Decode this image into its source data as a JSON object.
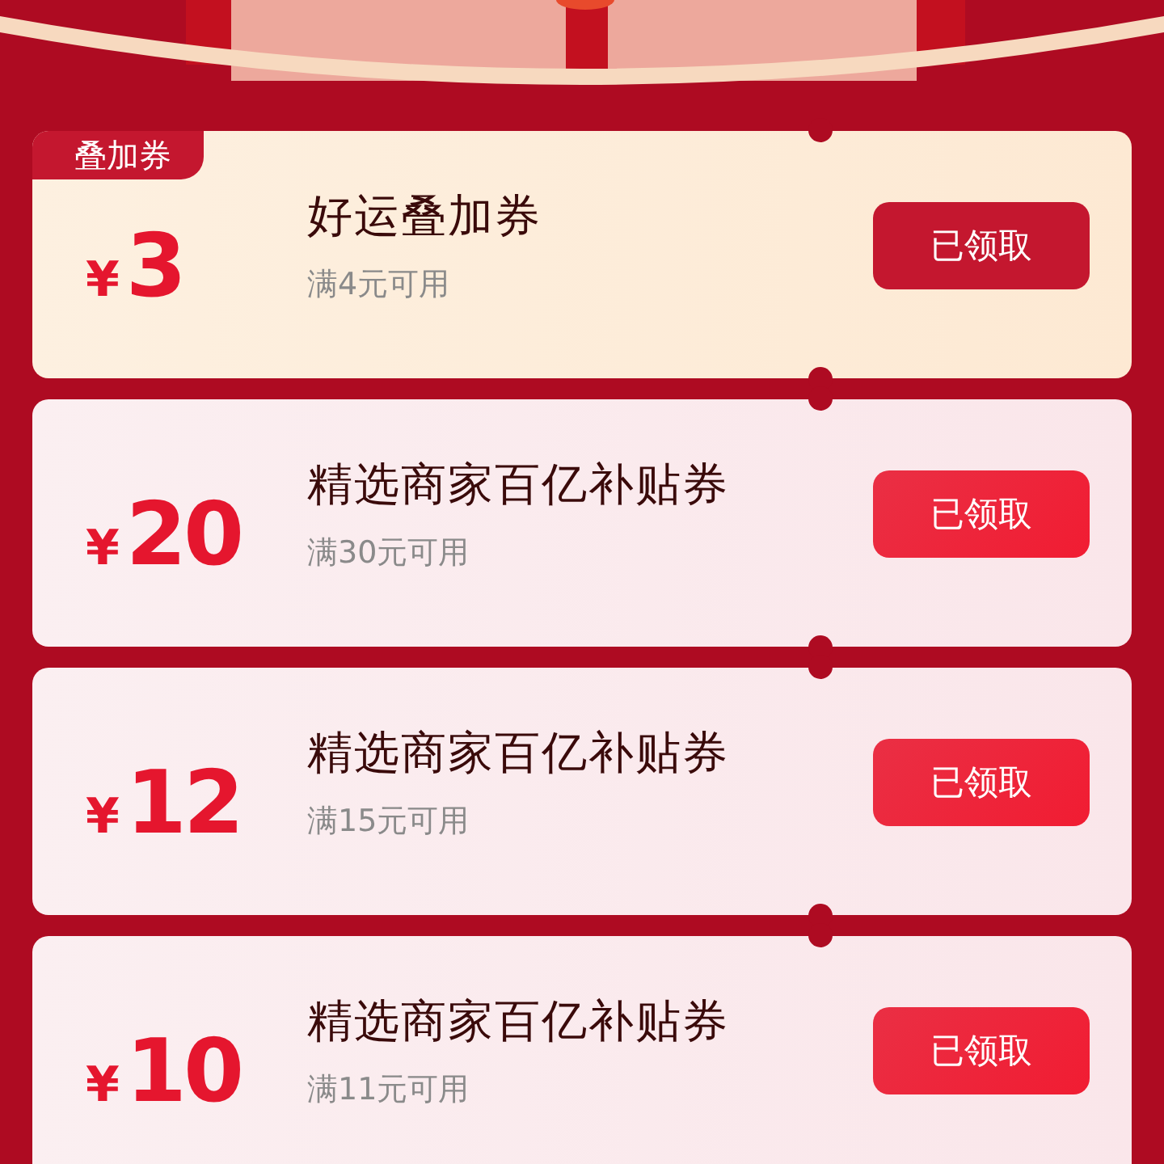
{
  "coupons": [
    {
      "kind": "stacking",
      "badge": "叠加券",
      "currency": "¥",
      "amount": "3",
      "title": "好运叠加券",
      "condition": "满4元可用",
      "button": "已领取"
    },
    {
      "kind": "standard",
      "currency": "¥",
      "amount": "20",
      "title": "精选商家百亿补贴券",
      "condition": "满30元可用",
      "button": "已领取"
    },
    {
      "kind": "standard",
      "currency": "¥",
      "amount": "12",
      "title": "精选商家百亿补贴券",
      "condition": "满15元可用",
      "button": "已领取"
    },
    {
      "kind": "standard",
      "currency": "¥",
      "amount": "10",
      "title": "精选商家百亿补贴券",
      "condition": "满11元可用",
      "button": "已领取"
    }
  ]
}
